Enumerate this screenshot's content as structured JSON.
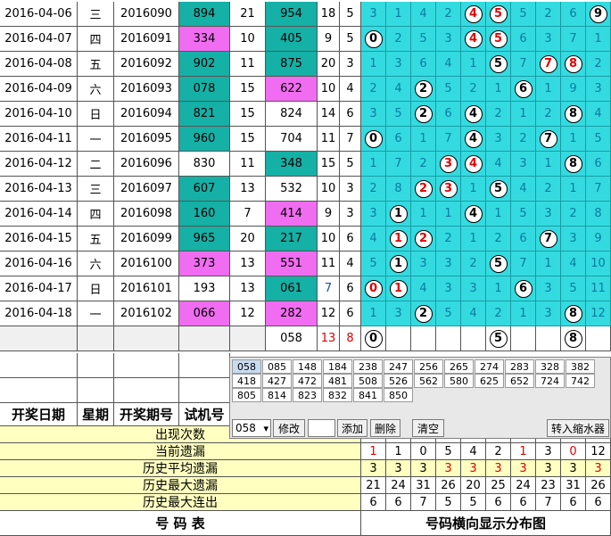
{
  "rows": [
    {
      "date": "2016-04-06",
      "weekday": "三",
      "issue": "2016090",
      "trial": "894",
      "trial_bg": "teal",
      "sum_a": "21",
      "draw": "954",
      "draw_bg": "teal",
      "span": "18",
      "n": "5",
      "grid": [
        [
          "3",
          0
        ],
        [
          "1",
          0
        ],
        [
          "4",
          0
        ],
        [
          "2",
          0
        ],
        [
          "4",
          2
        ],
        [
          "5",
          2
        ],
        [
          "5",
          0
        ],
        [
          "2",
          0
        ],
        [
          "6",
          0
        ],
        [
          "9",
          1
        ]
      ]
    },
    {
      "date": "2016-04-07",
      "weekday": "四",
      "issue": "2016091",
      "trial": "334",
      "trial_bg": "pink",
      "sum_a": "10",
      "draw": "405",
      "draw_bg": "teal",
      "span": "9",
      "n": "5",
      "grid": [
        [
          "0",
          1
        ],
        [
          "2",
          0
        ],
        [
          "5",
          0
        ],
        [
          "3",
          0
        ],
        [
          "4",
          2
        ],
        [
          "5",
          2
        ],
        [
          "6",
          0
        ],
        [
          "3",
          0
        ],
        [
          "7",
          0
        ],
        [
          "1",
          0
        ]
      ]
    },
    {
      "date": "2016-04-08",
      "weekday": "五",
      "issue": "2016092",
      "trial": "902",
      "trial_bg": "teal",
      "sum_a": "11",
      "draw": "875",
      "draw_bg": "teal",
      "span": "20",
      "n": "3",
      "grid": [
        [
          "1",
          0
        ],
        [
          "3",
          0
        ],
        [
          "6",
          0
        ],
        [
          "4",
          0
        ],
        [
          "1",
          0
        ],
        [
          "5",
          1
        ],
        [
          "7",
          0
        ],
        [
          "7",
          2
        ],
        [
          "8",
          2
        ],
        [
          "2",
          0
        ]
      ]
    },
    {
      "date": "2016-04-09",
      "weekday": "六",
      "issue": "2016093",
      "trial": "078",
      "trial_bg": "teal",
      "sum_a": "15",
      "draw": "622",
      "draw_bg": "pink",
      "span": "10",
      "n": "4",
      "grid": [
        [
          "2",
          0
        ],
        [
          "4",
          0
        ],
        [
          "2",
          1
        ],
        [
          "5",
          0
        ],
        [
          "2",
          0
        ],
        [
          "1",
          0
        ],
        [
          "6",
          1
        ],
        [
          "1",
          0
        ],
        [
          "9",
          0
        ],
        [
          "3",
          0
        ]
      ]
    },
    {
      "date": "2016-04-10",
      "weekday": "日",
      "issue": "2016094",
      "trial": "821",
      "trial_bg": "teal",
      "sum_a": "15",
      "draw": "824",
      "draw_bg": "plain",
      "span": "14",
      "n": "6",
      "grid": [
        [
          "3",
          0
        ],
        [
          "5",
          0
        ],
        [
          "2",
          1
        ],
        [
          "6",
          0
        ],
        [
          "4",
          1
        ],
        [
          "2",
          0
        ],
        [
          "1",
          0
        ],
        [
          "2",
          0
        ],
        [
          "8",
          1
        ],
        [
          "4",
          0
        ]
      ]
    },
    {
      "date": "2016-04-11",
      "weekday": "一",
      "issue": "2016095",
      "trial": "960",
      "trial_bg": "teal",
      "sum_a": "15",
      "draw": "704",
      "draw_bg": "plain",
      "span": "11",
      "n": "7",
      "grid": [
        [
          "0",
          1
        ],
        [
          "6",
          0
        ],
        [
          "1",
          0
        ],
        [
          "7",
          0
        ],
        [
          "4",
          1
        ],
        [
          "3",
          0
        ],
        [
          "2",
          0
        ],
        [
          "7",
          1
        ],
        [
          "1",
          0
        ],
        [
          "5",
          0
        ]
      ]
    },
    {
      "date": "2016-04-12",
      "weekday": "二",
      "issue": "2016096",
      "trial": "830",
      "trial_bg": "plain",
      "sum_a": "11",
      "draw": "348",
      "draw_bg": "teal",
      "span": "15",
      "n": "5",
      "grid": [
        [
          "1",
          0
        ],
        [
          "7",
          0
        ],
        [
          "2",
          0
        ],
        [
          "3",
          2
        ],
        [
          "4",
          2
        ],
        [
          "4",
          0
        ],
        [
          "3",
          0
        ],
        [
          "1",
          0
        ],
        [
          "8",
          1
        ],
        [
          "6",
          0
        ]
      ]
    },
    {
      "date": "2016-04-13",
      "weekday": "三",
      "issue": "2016097",
      "trial": "607",
      "trial_bg": "teal",
      "sum_a": "13",
      "draw": "532",
      "draw_bg": "plain",
      "span": "10",
      "n": "3",
      "grid": [
        [
          "2",
          0
        ],
        [
          "8",
          0
        ],
        [
          "2",
          2
        ],
        [
          "3",
          2
        ],
        [
          "1",
          0
        ],
        [
          "5",
          1
        ],
        [
          "4",
          0
        ],
        [
          "2",
          0
        ],
        [
          "1",
          0
        ],
        [
          "7",
          0
        ]
      ]
    },
    {
      "date": "2016-04-14",
      "weekday": "四",
      "issue": "2016098",
      "trial": "160",
      "trial_bg": "teal",
      "sum_a": "7",
      "draw": "414",
      "draw_bg": "pink",
      "span": "9",
      "n": "3",
      "grid": [
        [
          "3",
          0
        ],
        [
          "1",
          1
        ],
        [
          "1",
          0
        ],
        [
          "1",
          0
        ],
        [
          "4",
          1
        ],
        [
          "1",
          0
        ],
        [
          "5",
          0
        ],
        [
          "3",
          0
        ],
        [
          "2",
          0
        ],
        [
          "8",
          0
        ]
      ]
    },
    {
      "date": "2016-04-15",
      "weekday": "五",
      "issue": "2016099",
      "trial": "965",
      "trial_bg": "teal",
      "sum_a": "20",
      "draw": "217",
      "draw_bg": "teal",
      "span": "10",
      "n": "6",
      "grid": [
        [
          "4",
          0
        ],
        [
          "1",
          2
        ],
        [
          "2",
          2
        ],
        [
          "2",
          0
        ],
        [
          "1",
          0
        ],
        [
          "2",
          0
        ],
        [
          "6",
          0
        ],
        [
          "7",
          1
        ],
        [
          "3",
          0
        ],
        [
          "9",
          0
        ]
      ]
    },
    {
      "date": "2016-04-16",
      "weekday": "六",
      "issue": "2016100",
      "trial": "373",
      "trial_bg": "pink",
      "sum_a": "13",
      "draw": "551",
      "draw_bg": "pink",
      "span": "11",
      "n": "4",
      "grid": [
        [
          "5",
          0
        ],
        [
          "1",
          1
        ],
        [
          "3",
          0
        ],
        [
          "3",
          0
        ],
        [
          "2",
          0
        ],
        [
          "5",
          1
        ],
        [
          "7",
          0
        ],
        [
          "1",
          0
        ],
        [
          "4",
          0
        ],
        [
          "10",
          0
        ]
      ]
    },
    {
      "date": "2016-04-17",
      "weekday": "日",
      "issue": "2016101",
      "trial": "193",
      "trial_bg": "plain",
      "sum_a": "13",
      "draw": "061",
      "draw_bg": "teal",
      "span": "7",
      "n": "6",
      "grid": [
        [
          "0",
          2
        ],
        [
          "1",
          2
        ],
        [
          "4",
          0
        ],
        [
          "3",
          0
        ],
        [
          "3",
          0
        ],
        [
          "1",
          0
        ],
        [
          "6",
          1
        ],
        [
          "3",
          0
        ],
        [
          "5",
          0
        ],
        [
          "11",
          0
        ]
      ]
    },
    {
      "date": "2016-04-18",
      "weekday": "一",
      "issue": "2016102",
      "trial": "066",
      "trial_bg": "pink",
      "sum_a": "12",
      "draw": "282",
      "draw_bg": "pink",
      "span": "12",
      "n": "6",
      "grid": [
        [
          "1",
          0
        ],
        [
          "3",
          0
        ],
        [
          "2",
          1
        ],
        [
          "5",
          0
        ],
        [
          "4",
          0
        ],
        [
          "2",
          0
        ],
        [
          "1",
          0
        ],
        [
          "3",
          0
        ],
        [
          "8",
          1
        ],
        [
          "12",
          0
        ]
      ]
    }
  ],
  "current": {
    "draw": "058",
    "span": "13",
    "n": "8",
    "balls": {
      "0": "0",
      "5": "5",
      "8": "8"
    }
  },
  "header": {
    "date": "开奖日期",
    "weekday": "星期",
    "issue": "开奖期号",
    "trial": "试机号"
  },
  "popup": {
    "numbers": [
      "058",
      "085",
      "148",
      "184",
      "238",
      "247",
      "256",
      "265",
      "274",
      "283",
      "328",
      "382",
      "418",
      "427",
      "472",
      "481",
      "508",
      "526",
      "562",
      "580",
      "625",
      "652",
      "724",
      "742",
      "805",
      "814",
      "823",
      "832",
      "841",
      "850"
    ],
    "select_value": "058",
    "buttons": {
      "modify": "修改",
      "add": "添加",
      "delete": "删除",
      "clear": "清空",
      "transfer": "转入缩水器"
    }
  },
  "stats": [
    {
      "label": "出现次数",
      "values": [
        "",
        "",
        "",
        "",
        "",
        "",
        "",
        "",
        "",
        ""
      ]
    },
    {
      "label": "当前遗漏",
      "values": [
        "1",
        "1",
        "0",
        "5",
        "4",
        "2",
        "1",
        "3",
        "0",
        "12"
      ],
      "red": [
        0,
        6,
        8
      ]
    },
    {
      "label": "历史平均遗漏",
      "values": [
        "3",
        "3",
        "3",
        "3",
        "3",
        "3",
        "3",
        "3",
        "3",
        "3"
      ],
      "red": [
        3,
        4,
        5,
        6,
        9
      ]
    },
    {
      "label": "历史最大遗漏",
      "values": [
        "21",
        "24",
        "31",
        "26",
        "20",
        "25",
        "24",
        "23",
        "31",
        "26"
      ]
    },
    {
      "label": "历史最大连出",
      "values": [
        "6",
        "6",
        "7",
        "5",
        "5",
        "6",
        "6",
        "7",
        "6",
        "6"
      ]
    }
  ],
  "footer": {
    "left": "号  码  表",
    "right": "号码横向显示分布图"
  }
}
